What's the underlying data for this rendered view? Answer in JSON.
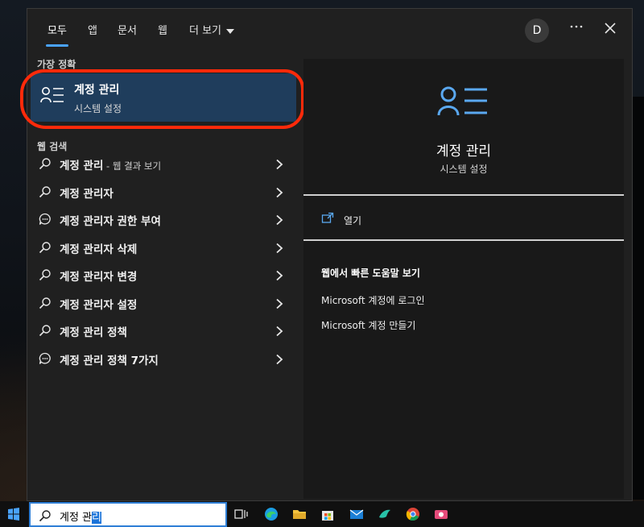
{
  "tabs": [
    {
      "label": "모두"
    },
    {
      "label": "앱"
    },
    {
      "label": "문서"
    },
    {
      "label": "웹"
    },
    {
      "label": "더 보기"
    }
  ],
  "user": {
    "avatar_letter": "D"
  },
  "best_match": {
    "header": "가장 정확",
    "title": "계정 관리",
    "subtitle": "시스템 설정"
  },
  "web_search": {
    "header": "웹 검색",
    "items": [
      {
        "label": "계정 관리",
        "suffix": " - 웹 결과 보기",
        "icon": "search-icon"
      },
      {
        "label": "계정 관리자",
        "suffix": "",
        "icon": "search-icon"
      },
      {
        "label": "계정 관리자 권한 부여",
        "suffix": "",
        "icon": "chat-bubble-icon"
      },
      {
        "label": "계정 관리자 삭제",
        "suffix": "",
        "icon": "search-icon"
      },
      {
        "label": "계정 관리자 변경",
        "suffix": "",
        "icon": "search-icon"
      },
      {
        "label": "계정 관리자 설정",
        "suffix": "",
        "icon": "search-icon"
      },
      {
        "label": "계정 관리 정책",
        "suffix": "",
        "icon": "search-icon"
      },
      {
        "label": "계정 관리 정책 7가지",
        "suffix": "",
        "icon": "chat-bubble-icon"
      }
    ]
  },
  "details": {
    "title": "계정 관리",
    "subtitle": "시스템 설정",
    "open_label": "열기",
    "help_header": "웹에서 빠른 도움말 보기",
    "help_links": [
      {
        "label": "Microsoft 계정에 로그인"
      },
      {
        "label": "Microsoft 계정 만들기"
      }
    ]
  },
  "taskbar": {
    "search_text_plain": "계정 관",
    "search_text_selected": "리"
  },
  "colors": {
    "accent": "#4aa3ff",
    "selected_item_bg": "#1f3d5c",
    "highlight_ring": "#ff2a0a"
  }
}
